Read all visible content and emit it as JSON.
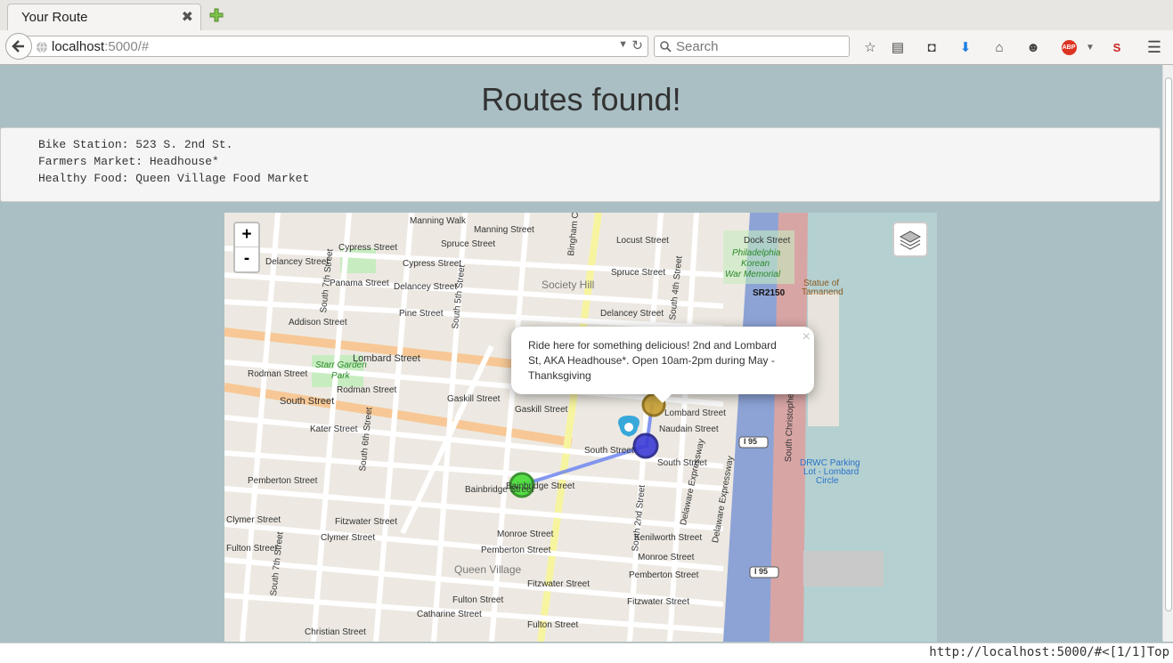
{
  "browser": {
    "tab_title": "Your Route",
    "url_host": "localhost",
    "url_rest": ":5000/#",
    "search_placeholder": "Search"
  },
  "page": {
    "title": "Routes found!",
    "info_lines": [
      "Bike Station: 523 S. 2nd St.",
      "Farmers Market: Headhouse*",
      "Healthy Food: Queen Village Food Market"
    ]
  },
  "map": {
    "zoom_in": "+",
    "zoom_out": "-",
    "popup_text": "Ride here for something delicious! 2nd and Lombard St, AKA Headhouse*. Open 10am-2pm during May - Thanksgiving",
    "popup_close": "×",
    "labels": {
      "manning_walk": "Manning Walk",
      "manning_street": "Manning Street",
      "spruce_street": "Spruce Street",
      "spruce_street_east": "Spruce Street",
      "locust_street": "Locust Street",
      "dock_street": "Dock Street",
      "cypress_street": "Cypress Street",
      "cypress_street_2": "Cypress Street",
      "delancey_street_w": "Delancey Street",
      "delancey_street_m": "Delancey Street",
      "delancey_street_e": "Delancey Street",
      "panama_street": "Panama Street",
      "pine_street": "Pine Street",
      "addison_street": "Addison Street",
      "society_hill": "Society Hill",
      "lombard_street": "Lombard Street",
      "lombard_street_e": "Lombard Street",
      "starr_garden": "Starr Garden",
      "park": "Park",
      "rodman_street": "Rodman Street",
      "rodman_street_2": "Rodman Street",
      "south_street_w": "South Street",
      "south_street_m": "South Street",
      "south_street_e": "South Street",
      "gaskill_street": "Gaskill Street",
      "gaskill_street_2": "Gaskill Street",
      "naudain_street": "Naudain Street",
      "kater_street": "Kater Street",
      "bainbridge_street": "Bainbridge Street",
      "bainbridge_street_2": "Bainbridge Street",
      "pemberton_street": "Pemberton Street",
      "pemberton_street_2": "Pemberton Street",
      "pemberton_street_3": "Pemberton Street",
      "fitzwater_street": "Fitzwater Street",
      "fitzwater_street_2": "Fitzwater Street",
      "fitzwater_street_3": "Fitzwater Street",
      "clymer_street": "Clymer Street",
      "clymer_street_2": "Clymer Street",
      "fulton_street": "Fulton Street",
      "fulton_street_2": "Fulton Street",
      "fulton_street_3": "Fulton Street",
      "monroe_street": "Monroe Street",
      "monroe_street_2": "Monroe Street",
      "queen_village": "Queen Village",
      "catharine_street": "Catharine Street",
      "christian_street": "Christian Street",
      "kenilworth_street": "Kenilworth Street",
      "philadelphia_korean": "Philadelphia",
      "korean": "Korean",
      "war_memorial": "War Memorial",
      "statue": "Statue of",
      "tamanend": "Tamanend",
      "sr2150": "SR2150",
      "i95": "I 95",
      "i95_2": "I 95",
      "drwc_parking": "DRWC Parking",
      "lot_lombard": "Lot - Lombard",
      "circle": "Circle",
      "delaware_expressway": "Delaware Expressway",
      "delaware_expressway_2": "Delaware Expressway",
      "south_christopher": "South Christopher",
      "south_2nd": "South 2nd Street",
      "south_5th": "South 5th Street",
      "south_6th": "South 6th Street",
      "south_7th": "South 7th Street",
      "south_7th_2": "South 7th Street",
      "south_4th": "South 4th Street",
      "bingham": "Bingham Co"
    }
  },
  "status_bar": {
    "text": "http://localhost:5000/#<[1/1]Top"
  },
  "colors": {
    "page_bg": "#aabfc4",
    "route_line": "#6e86f0",
    "bike_marker": "#3d3dd6",
    "food_marker": "#44dd33",
    "market_marker": "#c9a030",
    "info_marker": "#38a8da"
  }
}
